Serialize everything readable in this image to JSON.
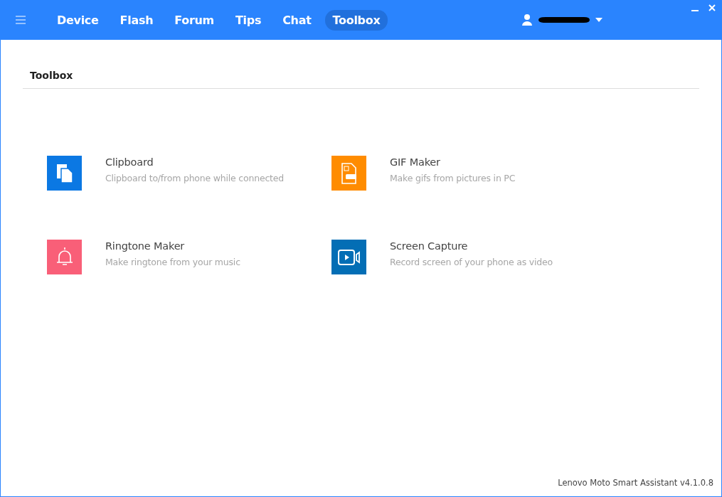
{
  "nav": {
    "tabs": [
      {
        "label": "Device",
        "selected": false
      },
      {
        "label": "Flash",
        "selected": false
      },
      {
        "label": "Forum",
        "selected": false
      },
      {
        "label": "Tips",
        "selected": false
      },
      {
        "label": "Chat",
        "selected": false
      },
      {
        "label": "Toolbox",
        "selected": true
      }
    ]
  },
  "section_title": "Toolbox",
  "tools": [
    {
      "kind": "clipboard",
      "color": "#0b78e3",
      "title": "Clipboard",
      "description": "Clipboard to/from phone while connected"
    },
    {
      "kind": "gif",
      "color": "#ff8c00",
      "title": "GIF Maker",
      "description": "Make gifs from pictures in PC"
    },
    {
      "kind": "ringtone",
      "color": "#f95f78",
      "title": "Ringtone Maker",
      "description": "Make ringtone from your music"
    },
    {
      "kind": "capture",
      "color": "#036eb5",
      "title": "Screen Capture",
      "description": "Record screen of your phone as video"
    }
  ],
  "footer": "Lenovo Moto Smart Assistant v4.1.0.8"
}
